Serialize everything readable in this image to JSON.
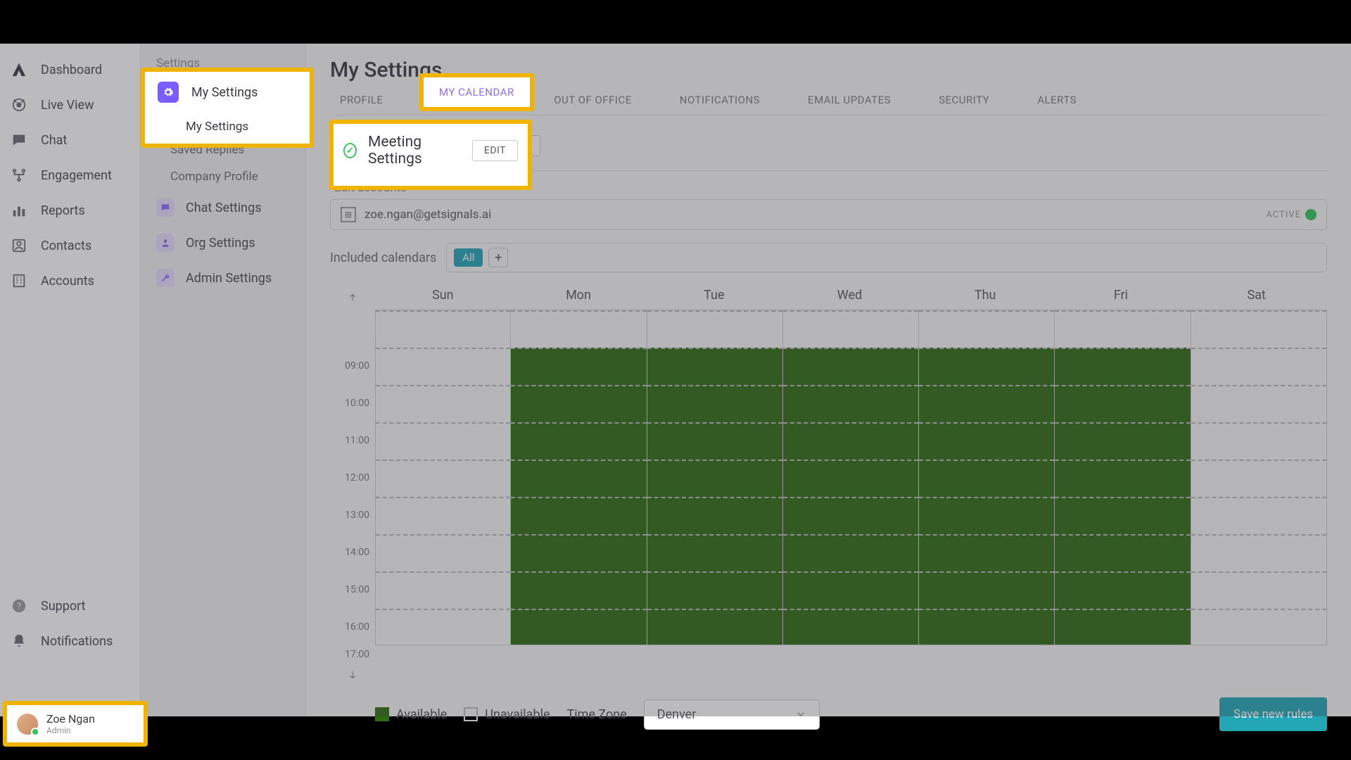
{
  "nav": {
    "items": [
      {
        "label": "Dashboard",
        "icon": "logo"
      },
      {
        "label": "Live View",
        "icon": "eye"
      },
      {
        "label": "Chat",
        "icon": "chat"
      },
      {
        "label": "Engagement",
        "icon": "branch"
      },
      {
        "label": "Reports",
        "icon": "bars"
      },
      {
        "label": "Contacts",
        "icon": "user"
      },
      {
        "label": "Accounts",
        "icon": "building"
      }
    ],
    "support": "Support",
    "notifications": "Notifications"
  },
  "user": {
    "name": "Zoe Ngan",
    "role": "Admin"
  },
  "settingsCol": {
    "title": "Settings",
    "groups": [
      {
        "label": "My Settings",
        "icon": "gear",
        "color": "#7b5cff",
        "subs": [
          "My Settings",
          "Saved Replies",
          "Company Profile"
        ]
      },
      {
        "label": "Chat Settings",
        "icon": "chat",
        "color": "#c8b6ff"
      },
      {
        "label": "Org Settings",
        "icon": "person",
        "color": "#c8b6ff"
      },
      {
        "label": "Admin Settings",
        "icon": "wrench",
        "color": "#c8b6ff"
      }
    ]
  },
  "page": {
    "title": "My Settings",
    "tabs": [
      "PROFILE",
      "MY CALENDAR",
      "OUT OF OFFICE",
      "NOTIFICATIONS",
      "EMAIL UPDATES",
      "SECURITY",
      "ALERTS"
    ],
    "activeTab": "MY CALENDAR"
  },
  "meeting": {
    "title": "Meeting Settings",
    "editLabel": "EDIT",
    "editAccounts": "Edit accounts",
    "account": {
      "email": "zoe.ngan@getsignals.ai",
      "status": "ACTIVE"
    }
  },
  "included": {
    "label": "Included calendars",
    "all": "All"
  },
  "calendar": {
    "days": [
      "Sun",
      "Mon",
      "Tue",
      "Wed",
      "Thu",
      "Fri",
      "Sat"
    ],
    "hours": [
      "09:00",
      "10:00",
      "11:00",
      "12:00",
      "13:00",
      "14:00",
      "15:00",
      "16:00",
      "17:00"
    ],
    "availableDays": [
      1,
      2,
      3,
      4,
      5
    ],
    "availStart": "09:00",
    "availEnd": "17:00"
  },
  "footer": {
    "available": "Available",
    "unavailable": "Unavailable",
    "tzLabel": "Time Zone",
    "tzValue": "Denver",
    "save": "Save new rules"
  },
  "highlights": {
    "mySettingsGroup": "My Settings",
    "mySettingsSub": "My Settings",
    "tab": "MY CALENDAR",
    "meeting": "Meeting Settings",
    "edit": "EDIT"
  }
}
